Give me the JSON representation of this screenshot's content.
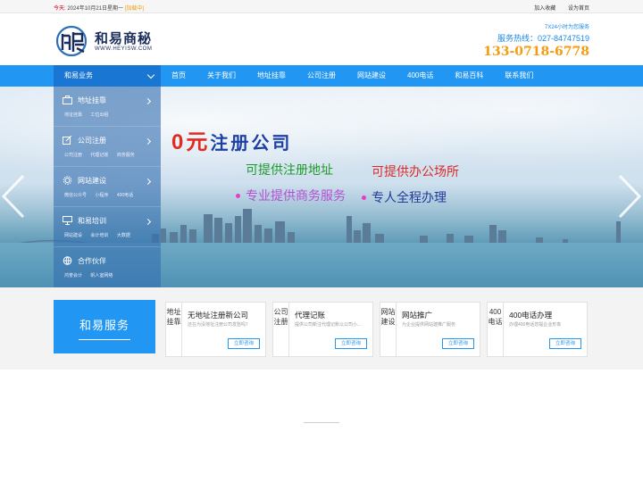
{
  "topbar": {
    "today_label": "今天:",
    "date": "2024年10月21日星期一",
    "weather": "[加载中]",
    "links": [
      "加入收藏",
      "设为首页"
    ]
  },
  "header": {
    "brand": "和易商秘",
    "url": "WWW.HEYISW.COM",
    "service_note": "7X24小时为您服务",
    "hotline": "服务热线：027-84747519",
    "phone": "133-0718-6778"
  },
  "nav": {
    "business_label": "和易业务",
    "items": [
      "首页",
      "关于我们",
      "地址挂靠",
      "公司注册",
      "网站建设",
      "400电话",
      "和易百科",
      "联系我们"
    ]
  },
  "sidebar": {
    "items": [
      {
        "title": "地址挂靠",
        "subs": [
          "地址挂靠",
          "工位出租"
        ],
        "icon": "briefcase-icon"
      },
      {
        "title": "公司注册",
        "subs": [
          "公司注册",
          "代理记账",
          "商务服务"
        ],
        "icon": "edit-icon"
      },
      {
        "title": "网站建设",
        "subs": [
          "微信公众号",
          "小程序",
          "400电话"
        ],
        "icon": "gear-icon"
      },
      {
        "title": "和易培训",
        "subs": [
          "网站建设",
          "会计培训",
          "大数据"
        ],
        "icon": "presentation-icon"
      },
      {
        "title": "合作伙伴",
        "subs": [
          "鸿誉会计",
          "帆人室网络"
        ],
        "icon": "globe-icon"
      }
    ]
  },
  "banner": {
    "headline_zero": "0元",
    "headline_text": "注册公司",
    "line1": "可提供注册地址",
    "line2": "可提供办公场所",
    "line3": "专业提供商务服务",
    "line4": "专人全程办理"
  },
  "services": {
    "title": "和易服务",
    "cards": [
      {
        "tag": "地址挂靠",
        "title": "无地址注册新公司",
        "desc": "还在为没地址注册公司发愁吗？",
        "button": "立即咨询"
      },
      {
        "tag": "公司注册",
        "title": "代理记账",
        "desc": "提供公司新注代理记账以公司小...",
        "button": "立即咨询"
      },
      {
        "tag": "网站建设",
        "title": "网站推广",
        "desc": "为企业提供网站建推广服务",
        "button": "立即咨询"
      },
      {
        "tag": "400电话",
        "title": "400电话办理",
        "desc": "办理400电话您提企业形象",
        "button": "立即咨询"
      }
    ]
  },
  "colors": {
    "primary_blue": "#2196f3",
    "dark_blue": "#1976d2",
    "phone_orange": "#f39c12",
    "promo_red": "#e32a21"
  }
}
